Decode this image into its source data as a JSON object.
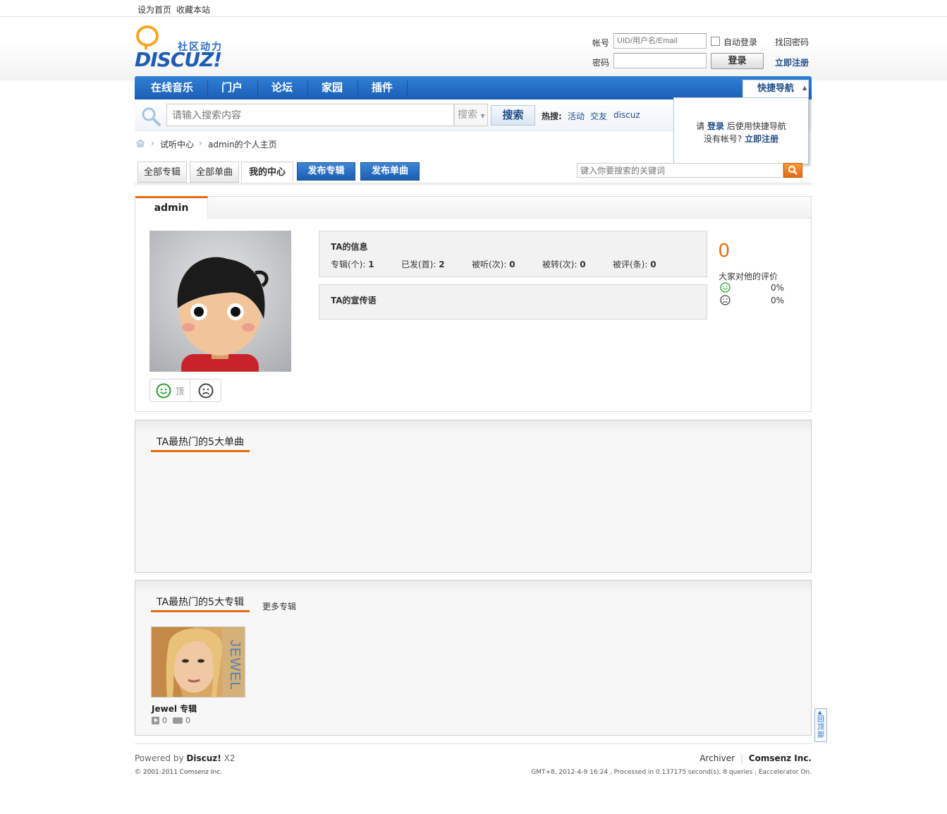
{
  "topbar": {
    "set_home": "设为首页",
    "bookmark": "收藏本站"
  },
  "logo": {
    "brand": "DISCUZ!",
    "tagline": "社区动力"
  },
  "login": {
    "account_label": "帐号",
    "account_placeholder": "UID/用户名/Email",
    "password_label": "密码",
    "auto_login": "自动登录",
    "forgot": "找回密码",
    "login_button": "登录",
    "register": "立即注册"
  },
  "nav": {
    "items": [
      "在线音乐",
      "门户",
      "论坛",
      "家园",
      "插件"
    ],
    "quicknav": "快捷导航"
  },
  "quickpop": {
    "pre": "请",
    "login": "登录",
    "post": "后使用快捷导航",
    "line2_pre": "没有帐号?",
    "register": "立即注册"
  },
  "search": {
    "placeholder": "请输入搜索内容",
    "type": "搜索",
    "button": "搜索",
    "hot_label": "热搜:",
    "hot": [
      "活动",
      "交友",
      "discuz"
    ]
  },
  "breadcrumb": {
    "items": [
      "试听中心",
      "admin的个人主页"
    ]
  },
  "tabs": {
    "all_albums": "全部专辑",
    "all_singles": "全部单曲",
    "my_center": "我的中心",
    "publish_album": "发布专辑",
    "publish_single": "发布单曲"
  },
  "music_search": {
    "placeholder": "键入你要搜索的关键词"
  },
  "profile": {
    "tab": "admin",
    "vote_up": "顶",
    "info_title": "TA的信息",
    "stats": [
      {
        "label": "专辑(个):",
        "value": "1"
      },
      {
        "label": "已发(首):",
        "value": "2"
      },
      {
        "label": "被听(次):",
        "value": "0"
      },
      {
        "label": "被转(次):",
        "value": "0"
      },
      {
        "label": "被评(条):",
        "value": "0"
      }
    ],
    "slogan_title": "TA的宣传语",
    "score": "0",
    "rating_label": "大家对他的评价",
    "good_pct": "0%",
    "bad_pct": "0%"
  },
  "top_singles": {
    "title": "TA最热门的5大单曲"
  },
  "top_albums": {
    "title": "TA最热门的5大专辑",
    "more": "更多专辑",
    "items": [
      {
        "name": "Jewel 专辑",
        "cover_text": "JEWEL",
        "plays": "0",
        "comments": "0"
      }
    ]
  },
  "backtop": "回顶部",
  "footer": {
    "powered_pre": "Powered by",
    "powered_brand": "Discuz!",
    "powered_ver": "X2",
    "copyright": "© 2001-2011 Comsenz Inc.",
    "archiver": "Archiver",
    "company": "Comsenz Inc.",
    "stats": "GMT+8, 2012-4-9 16:24 , Processed in 0.137175 second(s), 8 queries , Eaccelerator On."
  },
  "colors": {
    "nav": "#1f66bb",
    "accent": "#e5680f",
    "link": "#1e4d86"
  }
}
